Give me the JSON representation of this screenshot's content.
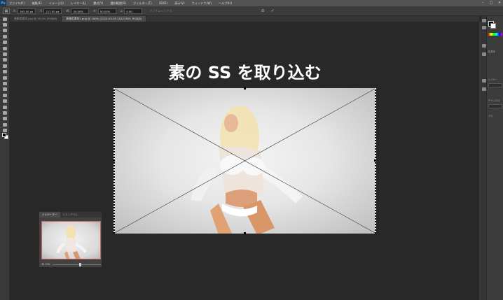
{
  "app": {
    "logo": "Ps"
  },
  "menu": [
    "ファイル(F)",
    "編集(E)",
    "イメージ(I)",
    "レイヤー(L)",
    "書式(Y)",
    "選択範囲(S)",
    "フィルター(T)",
    "3D(D)",
    "表示(V)",
    "ウィンドウ(W)",
    "ヘルプ(H)"
  ],
  "window_controls": {
    "minimize": "–",
    "maximize": "□",
    "close": "×"
  },
  "options": {
    "x_label": "X:",
    "x_value": "363.50 px",
    "y_label": "Y:",
    "y_value": "211.00 px",
    "w_label": "W:",
    "w_value": "50.00%",
    "h_label": "H:",
    "h_value": "50.00%",
    "angle_value": "0.00",
    "anti_alias": "アンチエイリアス",
    "cancel_glyph": "⊘",
    "commit_glyph": "✓"
  },
  "doc_tabs": [
    {
      "label": "装飾用素材.psd @ 33.3% (RGB/8)",
      "active": false
    },
    {
      "label": "装飾用素材1.png @ 100% (2015-03-05 20422355, RGB/8)",
      "active": true
    }
  ],
  "canvas": {
    "heading": "素の SS を取り込む"
  },
  "navigator": {
    "tabs": [
      {
        "label": "ナビゲーター",
        "active": true
      },
      {
        "label": "ヒストグラム",
        "active": false
      }
    ],
    "zoom": "33.33%",
    "zoom_fraction": 0.55
  },
  "right_panel": {
    "labels": [
      "色見本",
      "レイヤー",
      "チャンネル",
      "パス"
    ]
  },
  "colors": {
    "selection_border": "#c86464",
    "canvas_bg": "#282828"
  }
}
